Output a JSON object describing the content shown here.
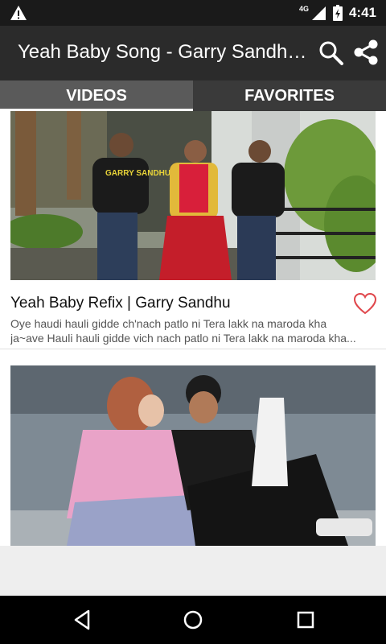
{
  "status_bar": {
    "network": "4G",
    "time": "4:41",
    "icons": [
      "warning-icon",
      "signal-icon",
      "battery-icon"
    ]
  },
  "app_bar": {
    "title": "Yeah Baby Song - Garry Sandhu Songs",
    "icons": [
      "search-icon",
      "share-icon"
    ],
    "background": "#2b2b2b"
  },
  "tabs": [
    {
      "label": "VIDEOS",
      "active": true
    },
    {
      "label": "FAVORITES",
      "active": false
    }
  ],
  "videos": [
    {
      "title": "Yeah Baby Refix | Garry Sandhu",
      "description_line1": "Oye haudi hauli gidde ch'nach patlo ni Tera lakk na maroda kha",
      "description_line2": "ja~ave Hauli hauli gidde vich nach patlo ni Tera lakk na maroda kha...",
      "favorite_icon": "heart-outline-icon",
      "thumbnail_text": "GARRY SANDHU"
    },
    {
      "title": "",
      "thumbnail": "couple-photo"
    }
  ],
  "nav_bar": {
    "icons": [
      "back-icon",
      "home-icon",
      "recents-icon"
    ]
  },
  "colors": {
    "heart": "#e0474c",
    "tab_active": "#5a5a5a",
    "tab_inactive": "#3a3a3a"
  }
}
